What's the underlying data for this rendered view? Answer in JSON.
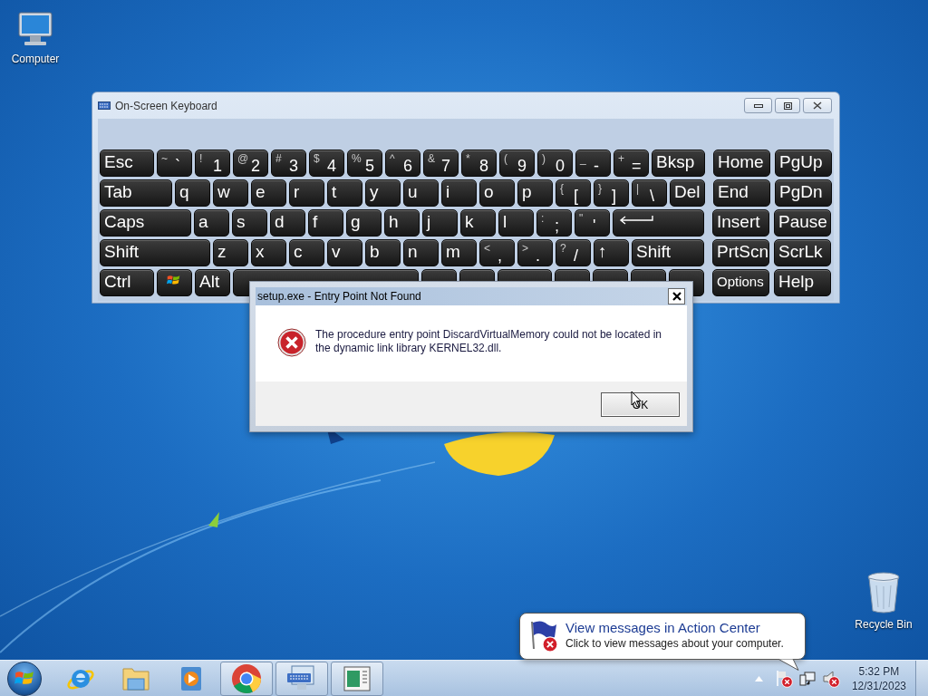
{
  "desktop_icons": [
    {
      "kind": "computer",
      "label": "Computer"
    },
    {
      "kind": "recycle",
      "label": "Recycle Bin"
    }
  ],
  "osk": {
    "title": "On-Screen Keyboard",
    "rows": [
      {
        "main": [
          {
            "kind": "text",
            "label": "Esc"
          },
          {
            "kind": "dual",
            "shift": "~",
            "label": "`"
          },
          {
            "kind": "dual",
            "shift": "!",
            "label": "1"
          },
          {
            "kind": "dual",
            "shift": "@",
            "label": "2"
          },
          {
            "kind": "dual",
            "shift": "#",
            "label": "3"
          },
          {
            "kind": "dual",
            "shift": "$",
            "label": "4"
          },
          {
            "kind": "dual",
            "shift": "%",
            "label": "5"
          },
          {
            "kind": "dual",
            "shift": "^",
            "label": "6"
          },
          {
            "kind": "dual",
            "shift": "&",
            "label": "7"
          },
          {
            "kind": "dual",
            "shift": "*",
            "label": "8"
          },
          {
            "kind": "dual",
            "shift": "(",
            "label": "9"
          },
          {
            "kind": "dual",
            "shift": ")",
            "label": "0"
          },
          {
            "kind": "dual",
            "shift": "_",
            "label": "-"
          },
          {
            "kind": "dual",
            "shift": "+",
            "label": "="
          },
          {
            "kind": "text",
            "label": "Bksp"
          }
        ],
        "nav": [
          {
            "kind": "text",
            "label": "Home"
          },
          {
            "kind": "text",
            "label": "PgUp"
          }
        ]
      },
      {
        "main": [
          {
            "kind": "text",
            "label": "Tab"
          },
          {
            "kind": "text",
            "label": "q"
          },
          {
            "kind": "text",
            "label": "w"
          },
          {
            "kind": "text",
            "label": "e"
          },
          {
            "kind": "text",
            "label": "r"
          },
          {
            "kind": "text",
            "label": "t"
          },
          {
            "kind": "text",
            "label": "y"
          },
          {
            "kind": "text",
            "label": "u"
          },
          {
            "kind": "text",
            "label": "i"
          },
          {
            "kind": "text",
            "label": "o"
          },
          {
            "kind": "text",
            "label": "p"
          },
          {
            "kind": "dual",
            "shift": "{",
            "label": "["
          },
          {
            "kind": "dual",
            "shift": "}",
            "label": "]"
          },
          {
            "kind": "dual",
            "shift": "|",
            "label": "\\"
          },
          {
            "kind": "text",
            "label": "Del"
          }
        ],
        "nav": [
          {
            "kind": "text",
            "label": "End"
          },
          {
            "kind": "text",
            "label": "PgDn"
          }
        ]
      },
      {
        "main": [
          {
            "kind": "text",
            "label": "Caps"
          },
          {
            "kind": "text",
            "label": "a"
          },
          {
            "kind": "text",
            "label": "s"
          },
          {
            "kind": "text",
            "label": "d"
          },
          {
            "kind": "text",
            "label": "f"
          },
          {
            "kind": "text",
            "label": "g"
          },
          {
            "kind": "text",
            "label": "h"
          },
          {
            "kind": "text",
            "label": "j"
          },
          {
            "kind": "text",
            "label": "k"
          },
          {
            "kind": "text",
            "label": "l"
          },
          {
            "kind": "dual",
            "shift": ":",
            "label": ";"
          },
          {
            "kind": "dual",
            "shift": "\"",
            "label": "'"
          },
          {
            "kind": "enter"
          }
        ],
        "nav": [
          {
            "kind": "text",
            "label": "Insert"
          },
          {
            "kind": "text",
            "label": "Pause"
          }
        ]
      },
      {
        "main": [
          {
            "kind": "text",
            "label": "Shift"
          },
          {
            "kind": "text",
            "label": "z"
          },
          {
            "kind": "text",
            "label": "x"
          },
          {
            "kind": "text",
            "label": "c"
          },
          {
            "kind": "text",
            "label": "v"
          },
          {
            "kind": "text",
            "label": "b"
          },
          {
            "kind": "text",
            "label": "n"
          },
          {
            "kind": "text",
            "label": "m"
          },
          {
            "kind": "dual",
            "shift": "<",
            "label": ","
          },
          {
            "kind": "dual",
            "shift": ">",
            "label": "."
          },
          {
            "kind": "dual",
            "shift": "?",
            "label": "/"
          },
          {
            "kind": "text",
            "label": "↑"
          },
          {
            "kind": "text",
            "label": "Shift"
          }
        ],
        "nav": [
          {
            "kind": "text",
            "label": "PrtScn"
          },
          {
            "kind": "text",
            "label": "ScrLk"
          }
        ]
      },
      {
        "main": [
          {
            "kind": "text",
            "label": "Ctrl"
          },
          {
            "kind": "windows"
          },
          {
            "kind": "text",
            "label": "Alt"
          },
          {
            "kind": "space"
          },
          {
            "kind": "covered"
          },
          {
            "kind": "covered"
          },
          {
            "kind": "covered"
          },
          {
            "kind": "covered"
          },
          {
            "kind": "covered"
          },
          {
            "kind": "covered"
          },
          {
            "kind": "covered"
          }
        ],
        "nav": [
          {
            "kind": "small",
            "label": "Options"
          },
          {
            "kind": "text",
            "label": "Help"
          }
        ]
      }
    ]
  },
  "dialog": {
    "title": "setup.exe - Entry Point Not Found",
    "message": "The procedure entry point DiscardVirtualMemory could not be located in the dynamic link library KERNEL32.dll.",
    "button": "OK"
  },
  "balloon": {
    "title": "View messages in Action Center",
    "body": "Click to view messages about your computer."
  },
  "taskbar": {
    "apps": [
      {
        "kind": "ie",
        "running": false
      },
      {
        "kind": "explorer",
        "running": false
      },
      {
        "kind": "media",
        "running": false
      },
      {
        "kind": "chrome",
        "running": true
      },
      {
        "kind": "keyboard",
        "running": true
      },
      {
        "kind": "window",
        "running": true
      }
    ],
    "time": "5:32 PM",
    "date": "12/31/2023"
  }
}
